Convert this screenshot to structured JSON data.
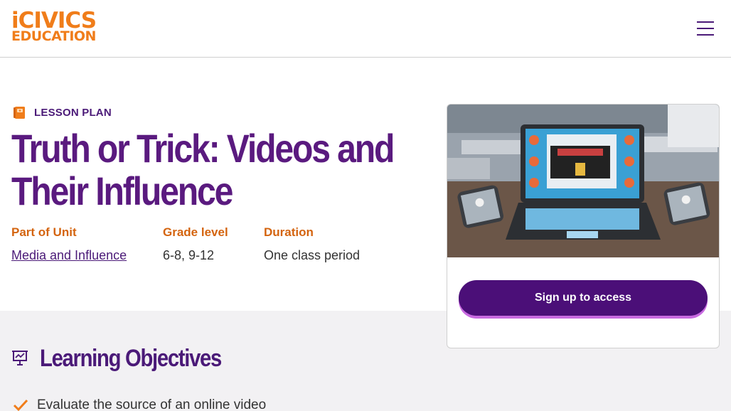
{
  "header": {
    "logo_top": "iCIVICS",
    "logo_bottom": "EDUCATION",
    "menu_icon": "hamburger-menu-icon"
  },
  "hero": {
    "tag_label": "LESSON PLAN",
    "title": "Truth or Trick: Videos and Their Influence",
    "meta": [
      {
        "label": "Part of Unit",
        "value": "Media and Influence"
      },
      {
        "label": "Grade level",
        "value": "6-8, 9-12"
      },
      {
        "label": "Duration",
        "value": "One class period"
      }
    ]
  },
  "card": {
    "image": "laptop-and-phones-illustration",
    "signup_label": "Sign up to access"
  },
  "objectives": {
    "title": "Learning Objectives",
    "items": [
      "Evaluate the source of an online video"
    ]
  },
  "colors": {
    "brand_orange": "#f07d1a",
    "brand_purple": "#4b1a78",
    "button_purple": "#4b0f78",
    "accent_orange": "#d4640f",
    "section_bg": "#f2f1f3"
  }
}
